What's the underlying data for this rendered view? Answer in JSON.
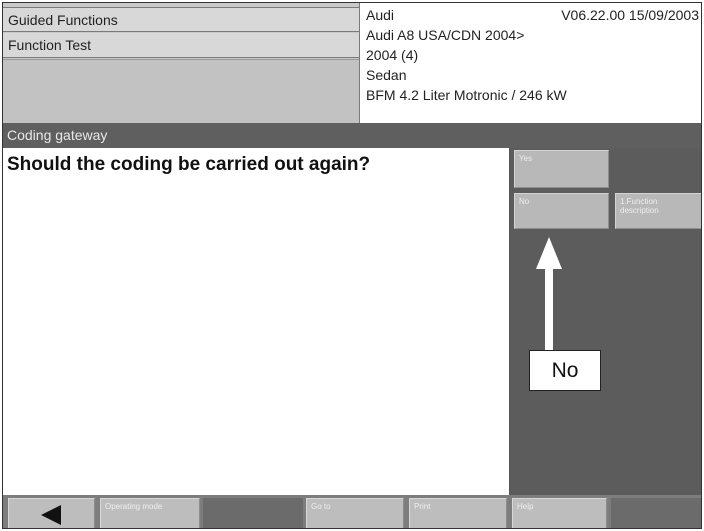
{
  "header": {
    "function_group": "Guided Functions",
    "function_name": "Function Test",
    "vehicle": {
      "brand": "Audi",
      "version": "V06.22.00 15/09/2003",
      "model": "Audi A8 USA/CDN 2004>",
      "year": "2004 (4)",
      "body": "Sedan",
      "engine": "BFM 4.2 Liter Motronic / 246 kW"
    }
  },
  "title_bar": {
    "text": "Coding gateway"
  },
  "main": {
    "question": "Should the coding be carried out again?"
  },
  "side_buttons": {
    "yes": "Yes",
    "no": "No",
    "function_description": "1.Function description"
  },
  "annotation": {
    "callout": "No"
  },
  "bottom_bar": {
    "operating_mode": "Operating mode",
    "goto": "Go to",
    "print": "Print",
    "help": "Help"
  }
}
